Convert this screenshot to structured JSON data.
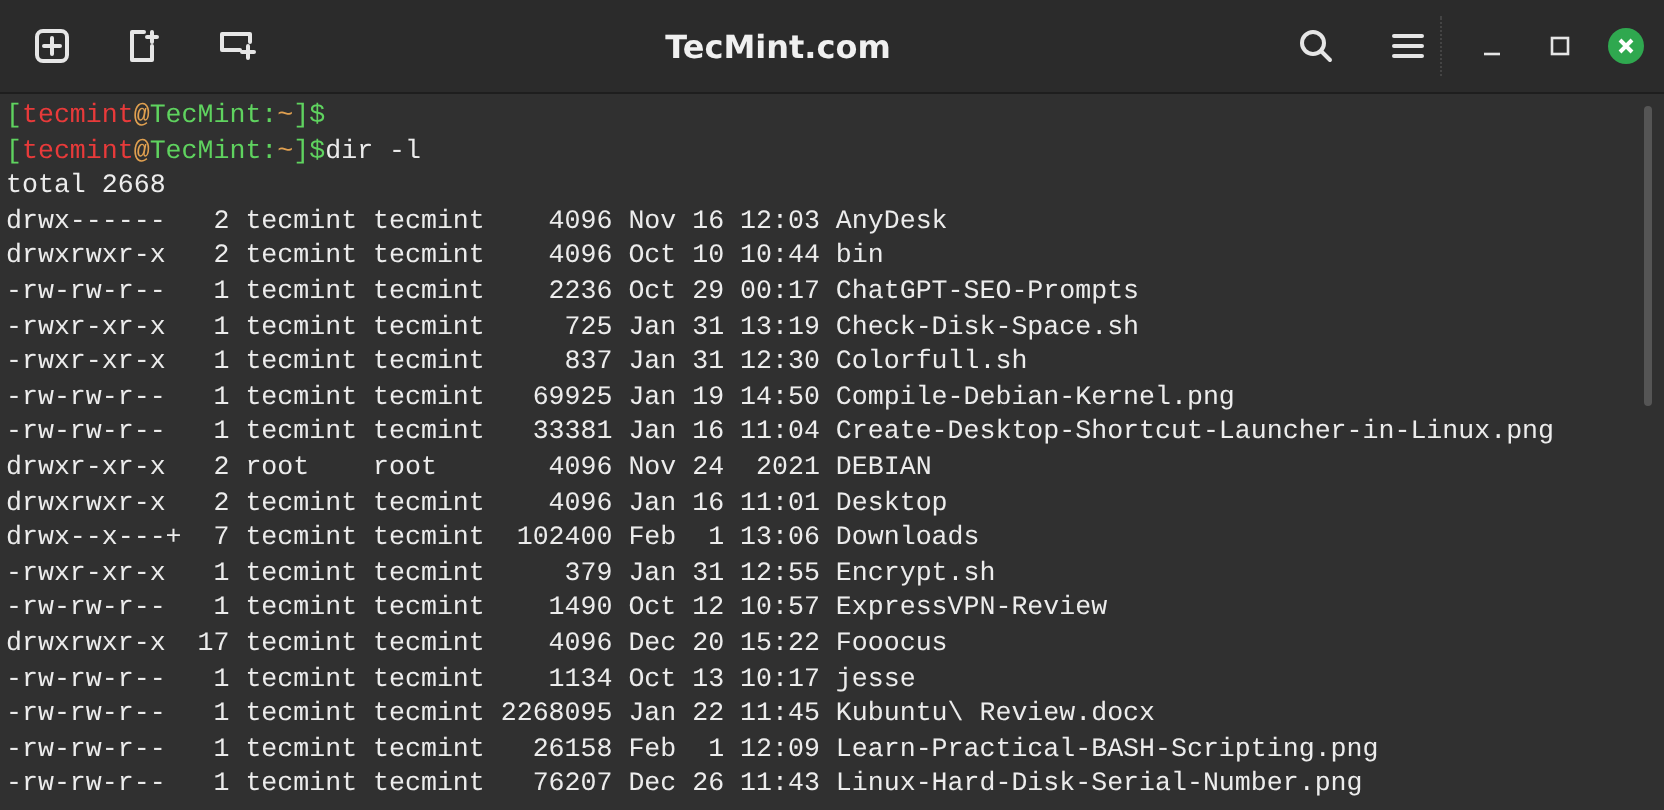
{
  "window": {
    "title": "TecMint.com"
  },
  "terminal": {
    "prompts": [
      {
        "segments": [
          {
            "text": "[",
            "color": "#5fd35f"
          },
          {
            "text": "tecmint",
            "color": "#e83a3a"
          },
          {
            "text": "@",
            "color": "#e0a050"
          },
          {
            "text": "TecMint:",
            "color": "#5fd35f"
          },
          {
            "text": "~",
            "color": "#e0a050"
          },
          {
            "text": "]$",
            "color": "#5fd35f"
          }
        ]
      },
      {
        "segments": [
          {
            "text": "[",
            "color": "#5fd35f"
          },
          {
            "text": "tecmint",
            "color": "#e83a3a"
          },
          {
            "text": "@",
            "color": "#e0a050"
          },
          {
            "text": "TecMint:",
            "color": "#5fd35f"
          },
          {
            "text": "~",
            "color": "#e0a050"
          },
          {
            "text": "]$",
            "color": "#5fd35f"
          }
        ],
        "command": "dir -l"
      }
    ],
    "output": [
      "total 2668",
      "drwx------   2 tecmint tecmint    4096 Nov 16 12:03 AnyDesk",
      "drwxrwxr-x   2 tecmint tecmint    4096 Oct 10 10:44 bin",
      "-rw-rw-r--   1 tecmint tecmint    2236 Oct 29 00:17 ChatGPT-SEO-Prompts",
      "-rwxr-xr-x   1 tecmint tecmint     725 Jan 31 13:19 Check-Disk-Space.sh",
      "-rwxr-xr-x   1 tecmint tecmint     837 Jan 31 12:30 Colorfull.sh",
      "-rw-rw-r--   1 tecmint tecmint   69925 Jan 19 14:50 Compile-Debian-Kernel.png",
      "-rw-rw-r--   1 tecmint tecmint   33381 Jan 16 11:04 Create-Desktop-Shortcut-Launcher-in-Linux.png",
      "drwxr-xr-x   2 root    root       4096 Nov 24  2021 DEBIAN",
      "drwxrwxr-x   2 tecmint tecmint    4096 Jan 16 11:01 Desktop",
      "drwx--x---+  7 tecmint tecmint  102400 Feb  1 13:06 Downloads",
      "-rwxr-xr-x   1 tecmint tecmint     379 Jan 31 12:55 Encrypt.sh",
      "-rw-rw-r--   1 tecmint tecmint    1490 Oct 12 10:57 ExpressVPN-Review",
      "drwxrwxr-x  17 tecmint tecmint    4096 Dec 20 15:22 Fooocus",
      "-rw-rw-r--   1 tecmint tecmint    1134 Oct 13 10:17 jesse",
      "-rw-rw-r--   1 tecmint tecmint 2268095 Jan 22 11:45 Kubuntu\\ Review.docx",
      "-rw-rw-r--   1 tecmint tecmint   26158 Feb  1 12:09 Learn-Practical-BASH-Scripting.png",
      "-rw-rw-r--   1 tecmint tecmint   76207 Dec 26 11:43 Linux-Hard-Disk-Serial-Number.png"
    ]
  }
}
